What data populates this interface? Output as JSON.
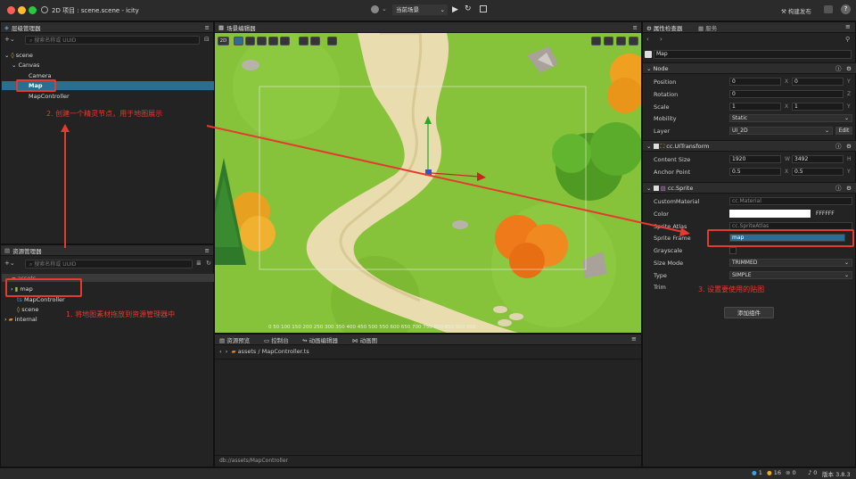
{
  "titlebar": {
    "title": "2D 项目 : scene.scene - icity",
    "scene_select": "当前场景",
    "build_btn": "构建发布"
  },
  "hierarchy": {
    "title": "层级管理器",
    "search_placeholder": "搜索名称或 UUID",
    "nodes": [
      "scene",
      "Canvas",
      "Camera",
      "Map",
      "MapController"
    ]
  },
  "assets": {
    "title": "资源管理器",
    "search_placeholder": "搜索名称或 UUID",
    "items": [
      "assets",
      "map",
      "MapController",
      "scene",
      "internal"
    ]
  },
  "scene_editor": {
    "title": "场景编辑器",
    "mode": "2D",
    "ruler": "0   50  100  150  200  250  300  350  400  450  500  550  600  650  700  750  800  850  900  950"
  },
  "bottom": {
    "tabs": [
      "资源预览",
      "控制台",
      "动画编辑器",
      "动画图"
    ],
    "path_root": "assets",
    "path_file": "MapController.ts",
    "status_path": "db://assets/MapController"
  },
  "inspector": {
    "tabs": [
      "属性检查器",
      "服务"
    ],
    "node_name": "Map",
    "node_section": "Node",
    "position": {
      "label": "Position",
      "x": "0",
      "y": "0"
    },
    "rotation": {
      "label": "Rotation",
      "z": "0"
    },
    "scale": {
      "label": "Scale",
      "x": "1",
      "y": "1"
    },
    "mobility": {
      "label": "Mobility",
      "value": "Static"
    },
    "layer": {
      "label": "Layer",
      "value": "UI_2D",
      "edit": "Edit"
    },
    "uitransform": {
      "title": "cc.UITransform",
      "content_size_label": "Content Size",
      "w": "1920",
      "h": "3492",
      "anchor_label": "Anchor Point",
      "ax": "0.5",
      "ay": "0.5"
    },
    "sprite": {
      "title": "cc.Sprite",
      "custom_material_label": "CustomMaterial",
      "custom_material": "cc.Material",
      "color_label": "Color",
      "color_hex": "FFFFFF",
      "atlas_label": "Sprite Atlas",
      "atlas": "cc.SpriteAtlas",
      "frame_label": "Sprite Frame",
      "frame": "map",
      "grayscale_label": "Grayscale",
      "size_mode_label": "Size Mode",
      "size_mode": "TRIMMED",
      "type_label": "Type",
      "type": "SIMPLE",
      "trim_label": "Trim"
    },
    "add_component": "添加组件",
    "axis": {
      "x": "X",
      "y": "Y",
      "z": "Z",
      "w": "W",
      "h": "H"
    }
  },
  "annotations": {
    "a1": "1. 将地图素材拖放到资源管理器中",
    "a2": "2. 创建一个精灵节点，用于地图展示",
    "a3": "3. 设置要使用的贴图"
  },
  "statusbar": {
    "info": "1",
    "warn": "16",
    "err": "0",
    "notif": "0",
    "version": "版本 3.8.3"
  },
  "colors": {
    "accent": "#2a6f8f",
    "annotation": "#e63a2e",
    "grass": "#8cc63f",
    "road": "#e9ddb0"
  }
}
